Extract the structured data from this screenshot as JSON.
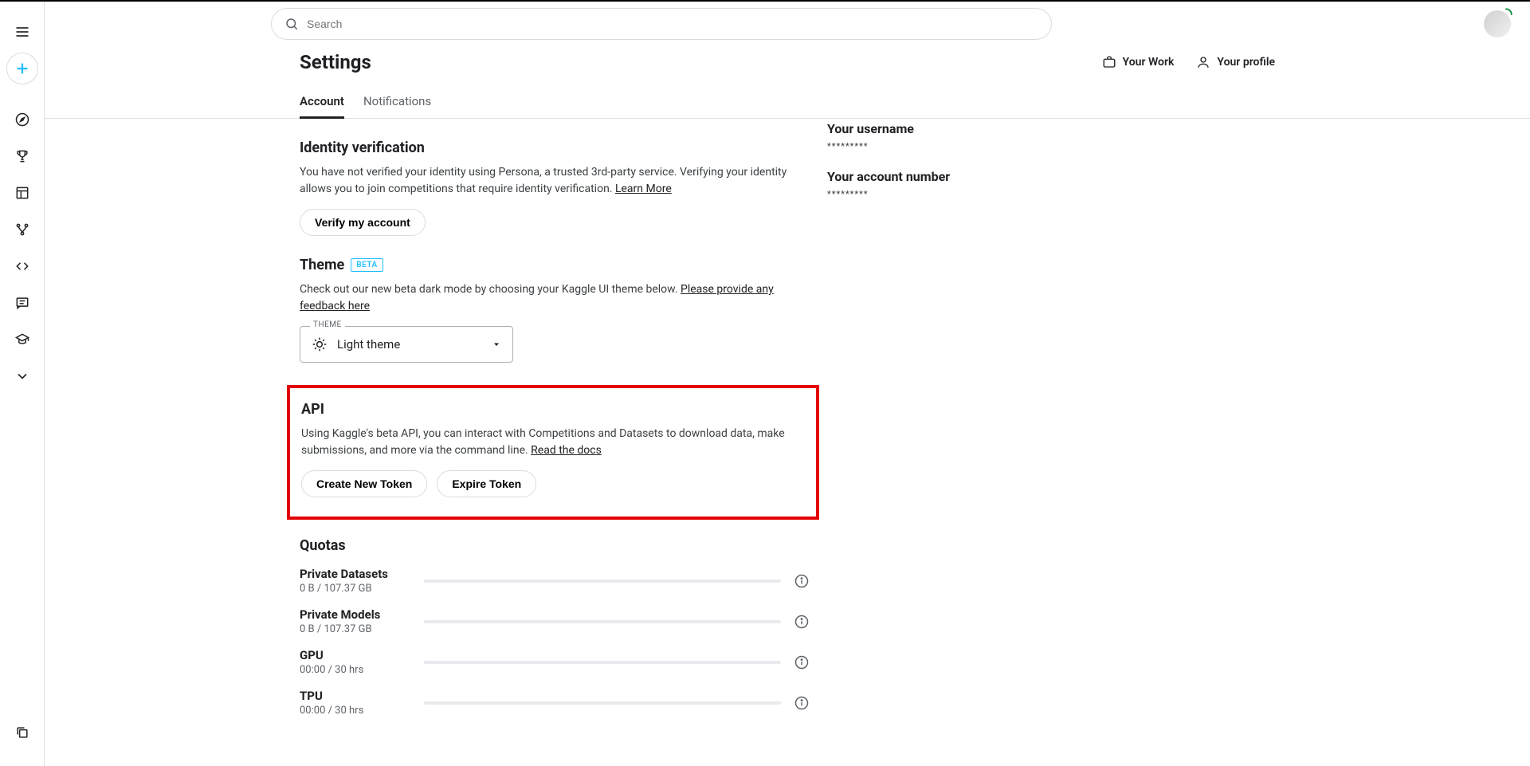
{
  "search": {
    "placeholder": "Search"
  },
  "header": {
    "title": "Settings",
    "actions": {
      "your_work": "Your Work",
      "your_profile": "Your profile"
    },
    "tabs": {
      "account": "Account",
      "notifications": "Notifications"
    }
  },
  "identity": {
    "title": "Identity verification",
    "desc_a": "You have not verified your identity using Persona, a trusted 3rd-party service. Verifying your identity allows you to join competitions that require identity verification. ",
    "learn_more": "Learn More",
    "verify_btn": "Verify my account"
  },
  "theme": {
    "title": "Theme",
    "badge": "BETA",
    "desc_a": "Check out our new beta dark mode by choosing your Kaggle UI theme below. ",
    "feedback_link": "Please provide any feedback here",
    "select_label": "THEME",
    "selected": "Light theme"
  },
  "api": {
    "title": "API",
    "desc_a": "Using Kaggle's beta API, you can interact with Competitions and Datasets to download data, make submissions, and more via the command line. ",
    "docs_link": "Read the docs",
    "create_btn": "Create New Token",
    "expire_btn": "Expire Token"
  },
  "quotas": {
    "title": "Quotas",
    "items": [
      {
        "name": "Private Datasets",
        "usage": "0 B / 107.37 GB"
      },
      {
        "name": "Private Models",
        "usage": "0 B / 107.37 GB"
      },
      {
        "name": "GPU",
        "usage": "00:00 / 30 hrs"
      },
      {
        "name": "TPU",
        "usage": "00:00 / 30 hrs"
      }
    ]
  },
  "right": {
    "username_label": "Your username",
    "username_value": "*********",
    "account_label": "Your account number",
    "account_value": "*********"
  }
}
